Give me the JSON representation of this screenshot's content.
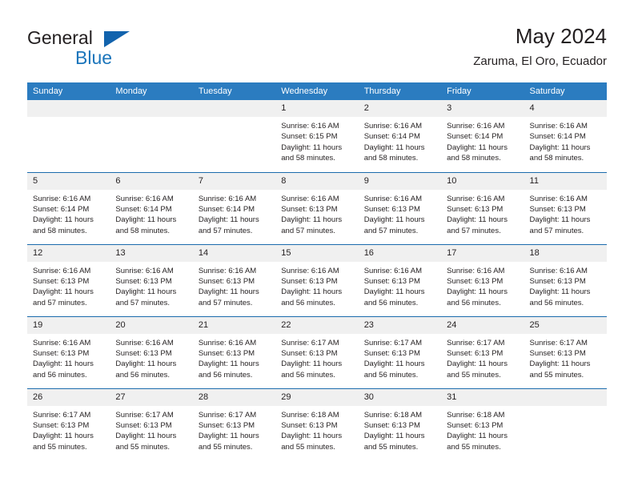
{
  "brand": {
    "name_part1": "General",
    "name_part2": "Blue",
    "logo_icon": "triangle-logo-icon"
  },
  "header": {
    "title": "May 2024",
    "subtitle": "Zaruma, El Oro, Ecuador"
  },
  "calendar": {
    "weekday_headers": [
      "Sunday",
      "Monday",
      "Tuesday",
      "Wednesday",
      "Thursday",
      "Friday",
      "Saturday"
    ],
    "accent_color": "#2b7cc0",
    "row_separator_color": "#1b6bad",
    "daynum_background": "#f0f0f0",
    "weeks": [
      [
        {
          "day": "",
          "empty": true,
          "sunrise": "",
          "sunset": "",
          "daylight1": "",
          "daylight2": ""
        },
        {
          "day": "",
          "empty": true,
          "sunrise": "",
          "sunset": "",
          "daylight1": "",
          "daylight2": ""
        },
        {
          "day": "",
          "empty": true,
          "sunrise": "",
          "sunset": "",
          "daylight1": "",
          "daylight2": ""
        },
        {
          "day": "1",
          "empty": false,
          "sunrise": "Sunrise: 6:16 AM",
          "sunset": "Sunset: 6:15 PM",
          "daylight1": "Daylight: 11 hours",
          "daylight2": "and 58 minutes."
        },
        {
          "day": "2",
          "empty": false,
          "sunrise": "Sunrise: 6:16 AM",
          "sunset": "Sunset: 6:14 PM",
          "daylight1": "Daylight: 11 hours",
          "daylight2": "and 58 minutes."
        },
        {
          "day": "3",
          "empty": false,
          "sunrise": "Sunrise: 6:16 AM",
          "sunset": "Sunset: 6:14 PM",
          "daylight1": "Daylight: 11 hours",
          "daylight2": "and 58 minutes."
        },
        {
          "day": "4",
          "empty": false,
          "sunrise": "Sunrise: 6:16 AM",
          "sunset": "Sunset: 6:14 PM",
          "daylight1": "Daylight: 11 hours",
          "daylight2": "and 58 minutes."
        }
      ],
      [
        {
          "day": "5",
          "empty": false,
          "sunrise": "Sunrise: 6:16 AM",
          "sunset": "Sunset: 6:14 PM",
          "daylight1": "Daylight: 11 hours",
          "daylight2": "and 58 minutes."
        },
        {
          "day": "6",
          "empty": false,
          "sunrise": "Sunrise: 6:16 AM",
          "sunset": "Sunset: 6:14 PM",
          "daylight1": "Daylight: 11 hours",
          "daylight2": "and 58 minutes."
        },
        {
          "day": "7",
          "empty": false,
          "sunrise": "Sunrise: 6:16 AM",
          "sunset": "Sunset: 6:14 PM",
          "daylight1": "Daylight: 11 hours",
          "daylight2": "and 57 minutes."
        },
        {
          "day": "8",
          "empty": false,
          "sunrise": "Sunrise: 6:16 AM",
          "sunset": "Sunset: 6:13 PM",
          "daylight1": "Daylight: 11 hours",
          "daylight2": "and 57 minutes."
        },
        {
          "day": "9",
          "empty": false,
          "sunrise": "Sunrise: 6:16 AM",
          "sunset": "Sunset: 6:13 PM",
          "daylight1": "Daylight: 11 hours",
          "daylight2": "and 57 minutes."
        },
        {
          "day": "10",
          "empty": false,
          "sunrise": "Sunrise: 6:16 AM",
          "sunset": "Sunset: 6:13 PM",
          "daylight1": "Daylight: 11 hours",
          "daylight2": "and 57 minutes."
        },
        {
          "day": "11",
          "empty": false,
          "sunrise": "Sunrise: 6:16 AM",
          "sunset": "Sunset: 6:13 PM",
          "daylight1": "Daylight: 11 hours",
          "daylight2": "and 57 minutes."
        }
      ],
      [
        {
          "day": "12",
          "empty": false,
          "sunrise": "Sunrise: 6:16 AM",
          "sunset": "Sunset: 6:13 PM",
          "daylight1": "Daylight: 11 hours",
          "daylight2": "and 57 minutes."
        },
        {
          "day": "13",
          "empty": false,
          "sunrise": "Sunrise: 6:16 AM",
          "sunset": "Sunset: 6:13 PM",
          "daylight1": "Daylight: 11 hours",
          "daylight2": "and 57 minutes."
        },
        {
          "day": "14",
          "empty": false,
          "sunrise": "Sunrise: 6:16 AM",
          "sunset": "Sunset: 6:13 PM",
          "daylight1": "Daylight: 11 hours",
          "daylight2": "and 57 minutes."
        },
        {
          "day": "15",
          "empty": false,
          "sunrise": "Sunrise: 6:16 AM",
          "sunset": "Sunset: 6:13 PM",
          "daylight1": "Daylight: 11 hours",
          "daylight2": "and 56 minutes."
        },
        {
          "day": "16",
          "empty": false,
          "sunrise": "Sunrise: 6:16 AM",
          "sunset": "Sunset: 6:13 PM",
          "daylight1": "Daylight: 11 hours",
          "daylight2": "and 56 minutes."
        },
        {
          "day": "17",
          "empty": false,
          "sunrise": "Sunrise: 6:16 AM",
          "sunset": "Sunset: 6:13 PM",
          "daylight1": "Daylight: 11 hours",
          "daylight2": "and 56 minutes."
        },
        {
          "day": "18",
          "empty": false,
          "sunrise": "Sunrise: 6:16 AM",
          "sunset": "Sunset: 6:13 PM",
          "daylight1": "Daylight: 11 hours",
          "daylight2": "and 56 minutes."
        }
      ],
      [
        {
          "day": "19",
          "empty": false,
          "sunrise": "Sunrise: 6:16 AM",
          "sunset": "Sunset: 6:13 PM",
          "daylight1": "Daylight: 11 hours",
          "daylight2": "and 56 minutes."
        },
        {
          "day": "20",
          "empty": false,
          "sunrise": "Sunrise: 6:16 AM",
          "sunset": "Sunset: 6:13 PM",
          "daylight1": "Daylight: 11 hours",
          "daylight2": "and 56 minutes."
        },
        {
          "day": "21",
          "empty": false,
          "sunrise": "Sunrise: 6:16 AM",
          "sunset": "Sunset: 6:13 PM",
          "daylight1": "Daylight: 11 hours",
          "daylight2": "and 56 minutes."
        },
        {
          "day": "22",
          "empty": false,
          "sunrise": "Sunrise: 6:17 AM",
          "sunset": "Sunset: 6:13 PM",
          "daylight1": "Daylight: 11 hours",
          "daylight2": "and 56 minutes."
        },
        {
          "day": "23",
          "empty": false,
          "sunrise": "Sunrise: 6:17 AM",
          "sunset": "Sunset: 6:13 PM",
          "daylight1": "Daylight: 11 hours",
          "daylight2": "and 56 minutes."
        },
        {
          "day": "24",
          "empty": false,
          "sunrise": "Sunrise: 6:17 AM",
          "sunset": "Sunset: 6:13 PM",
          "daylight1": "Daylight: 11 hours",
          "daylight2": "and 55 minutes."
        },
        {
          "day": "25",
          "empty": false,
          "sunrise": "Sunrise: 6:17 AM",
          "sunset": "Sunset: 6:13 PM",
          "daylight1": "Daylight: 11 hours",
          "daylight2": "and 55 minutes."
        }
      ],
      [
        {
          "day": "26",
          "empty": false,
          "sunrise": "Sunrise: 6:17 AM",
          "sunset": "Sunset: 6:13 PM",
          "daylight1": "Daylight: 11 hours",
          "daylight2": "and 55 minutes."
        },
        {
          "day": "27",
          "empty": false,
          "sunrise": "Sunrise: 6:17 AM",
          "sunset": "Sunset: 6:13 PM",
          "daylight1": "Daylight: 11 hours",
          "daylight2": "and 55 minutes."
        },
        {
          "day": "28",
          "empty": false,
          "sunrise": "Sunrise: 6:17 AM",
          "sunset": "Sunset: 6:13 PM",
          "daylight1": "Daylight: 11 hours",
          "daylight2": "and 55 minutes."
        },
        {
          "day": "29",
          "empty": false,
          "sunrise": "Sunrise: 6:18 AM",
          "sunset": "Sunset: 6:13 PM",
          "daylight1": "Daylight: 11 hours",
          "daylight2": "and 55 minutes."
        },
        {
          "day": "30",
          "empty": false,
          "sunrise": "Sunrise: 6:18 AM",
          "sunset": "Sunset: 6:13 PM",
          "daylight1": "Daylight: 11 hours",
          "daylight2": "and 55 minutes."
        },
        {
          "day": "31",
          "empty": false,
          "sunrise": "Sunrise: 6:18 AM",
          "sunset": "Sunset: 6:13 PM",
          "daylight1": "Daylight: 11 hours",
          "daylight2": "and 55 minutes."
        },
        {
          "day": "",
          "empty": true,
          "sunrise": "",
          "sunset": "",
          "daylight1": "",
          "daylight2": ""
        }
      ]
    ]
  }
}
